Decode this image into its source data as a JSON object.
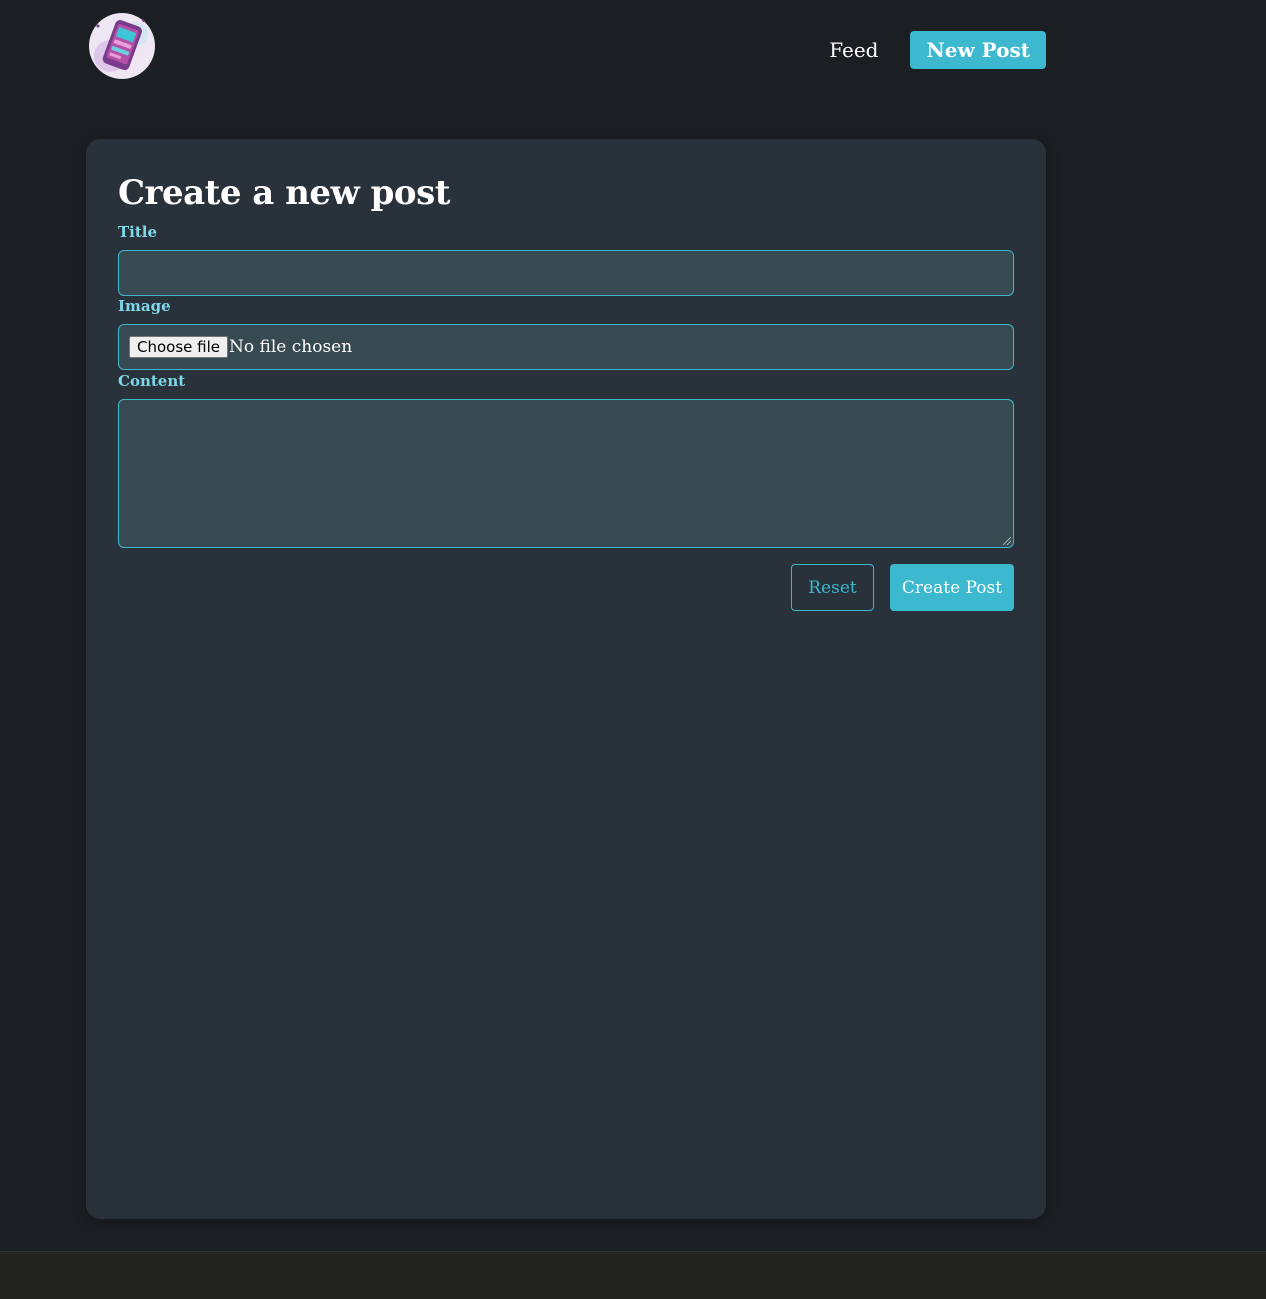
{
  "nav": {
    "logo_icon": "phone-app-logo-icon",
    "links": {
      "feed": "Feed",
      "new_post": "New Post"
    }
  },
  "form": {
    "title": "Create a new post",
    "fields": {
      "title_label": "Title",
      "title_value": "",
      "image_label": "Image",
      "image_button": "Choose file",
      "image_status": "No file chosen",
      "content_label": "Content",
      "content_value": ""
    },
    "buttons": {
      "reset": "Reset",
      "create": "Create Post"
    }
  },
  "colors": {
    "accent": "#3cb9cf",
    "background": "#1b1f24",
    "card": "#29313a",
    "input": "#374a52",
    "label": "#7dd8e8"
  }
}
